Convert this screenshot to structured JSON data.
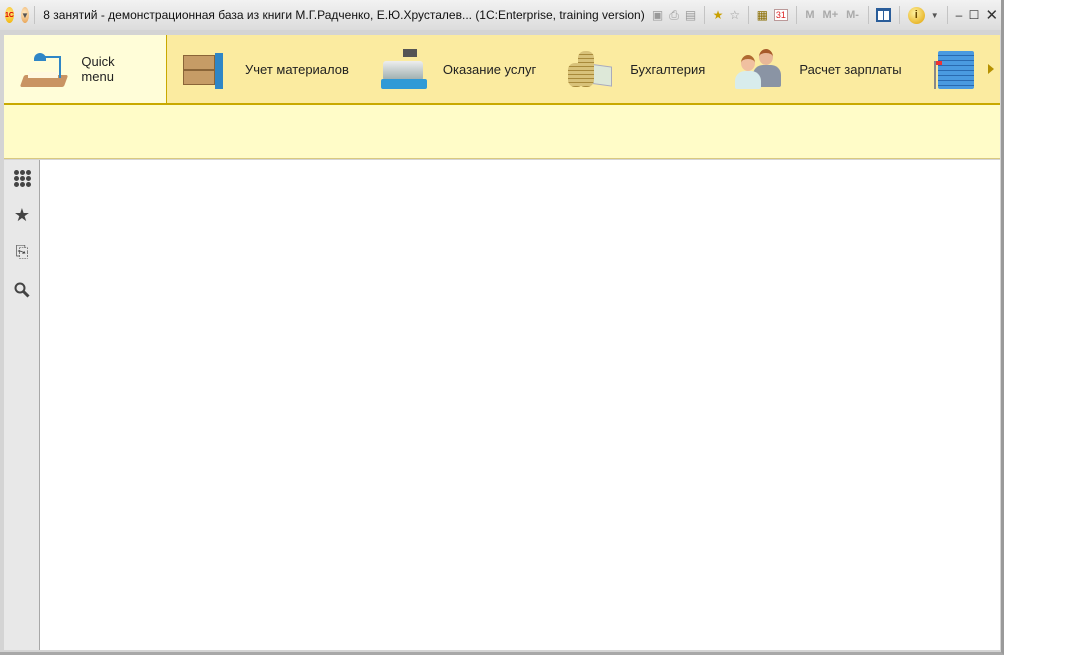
{
  "window": {
    "title": "8 занятий - демонстрационная база из книги М.Г.Радченко, Е.Ю.Хрусталев...  (1C:Enterprise, training version)",
    "logo": "1С"
  },
  "toolbar": {
    "memory_buttons": [
      "M",
      "M+",
      "M-"
    ],
    "calendar_day": "31"
  },
  "sections": [
    {
      "label": "Quick menu",
      "icon": "desk-lamp-icon",
      "active": true
    },
    {
      "label": "Учет материалов",
      "icon": "pallet-boxes-icon"
    },
    {
      "label": "Оказание услуг",
      "icon": "cash-register-icon"
    },
    {
      "label": "Бухгалтерия",
      "icon": "coins-icon"
    },
    {
      "label": "Расчет зарплаты",
      "icon": "people-icon"
    },
    {
      "label": "",
      "icon": "building-icon"
    }
  ],
  "sidebar": [
    "apps-grid-icon",
    "favorites-star-icon",
    "history-icon",
    "search-icon"
  ]
}
